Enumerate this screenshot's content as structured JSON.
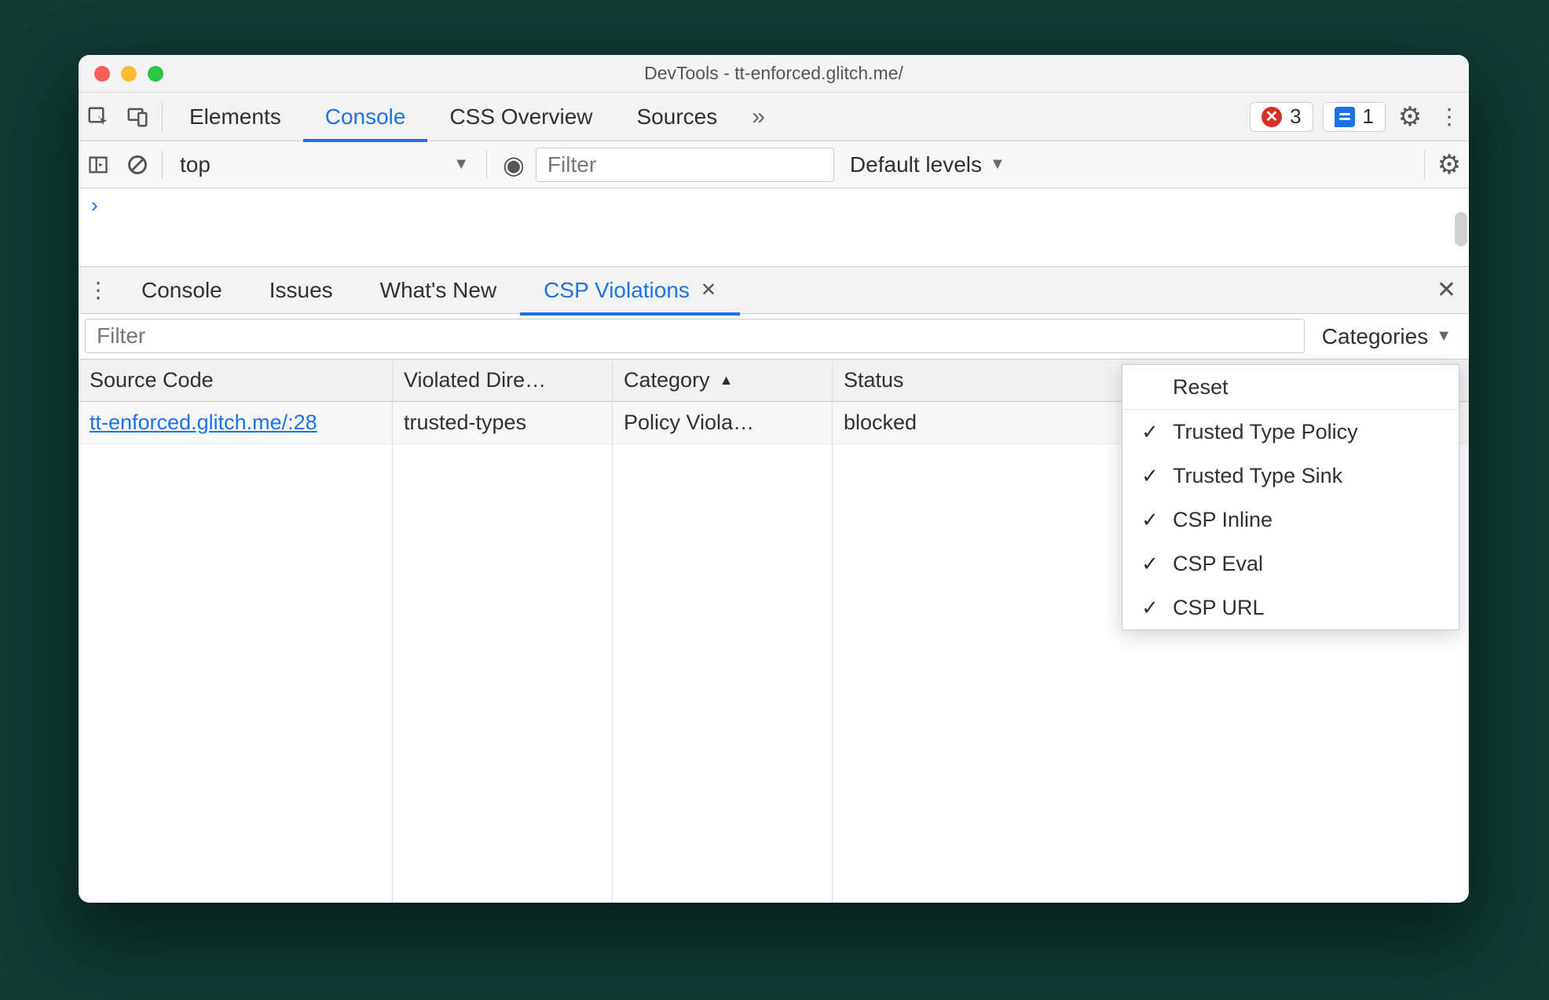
{
  "window_title": "DevTools - tt-enforced.glitch.me/",
  "main_tabs": [
    "Elements",
    "Console",
    "CSS Overview",
    "Sources"
  ],
  "main_active": "Console",
  "status": {
    "errors": 3,
    "messages": 1
  },
  "console_toolbar": {
    "context": "top",
    "filter_placeholder": "Filter",
    "levels_label": "Default levels"
  },
  "drawer_tabs": [
    "Console",
    "Issues",
    "What's New",
    "CSP Violations"
  ],
  "drawer_active": "CSP Violations",
  "drawer_filter_placeholder": "Filter",
  "categories_label": "Categories",
  "columns": {
    "source": "Source Code",
    "directive": "Violated Dire…",
    "category": "Category",
    "status": "Status"
  },
  "rows": [
    {
      "source": "tt-enforced.glitch.me/:28",
      "directive": "trusted-types",
      "category": "Policy Viola…",
      "status": "blocked"
    }
  ],
  "popup": {
    "reset": "Reset",
    "items": [
      "Trusted Type Policy",
      "Trusted Type Sink",
      "CSP Inline",
      "CSP Eval",
      "CSP URL"
    ]
  }
}
